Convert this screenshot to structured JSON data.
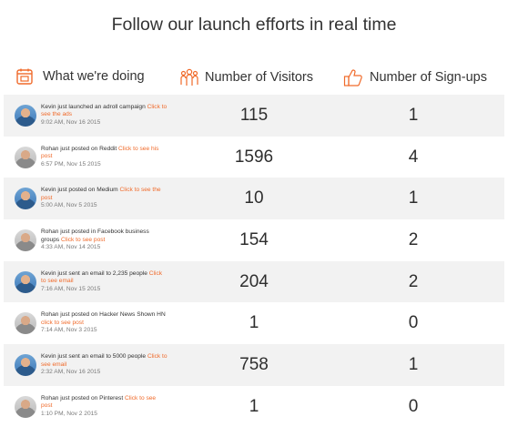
{
  "page": {
    "title": "Follow our launch efforts in real time"
  },
  "header": {
    "doing_label": "What we're doing",
    "visitors_label": "Number of Visitors",
    "signups_label": "Number of Sign-ups",
    "doing_icon": "calendar-icon",
    "visitors_icon": "people-icon",
    "signups_icon": "thumbs-up-icon",
    "accent_color": "#f06a2a"
  },
  "rows": [
    {
      "person": "kevin",
      "text": "Kevin just launched an adroll campaign ",
      "link": "Click to see the ads",
      "time": "9:02 AM, Nov 16 2015",
      "visitors": "115",
      "signups": "1"
    },
    {
      "person": "rohan",
      "text": "Rohan just posted on Reddit ",
      "link": "Click to see his post",
      "time": "6:57 PM, Nov 15 2015",
      "visitors": "1596",
      "signups": "4"
    },
    {
      "person": "kevin",
      "text": "Kevin just posted on Medium ",
      "link": "Click to see the post",
      "time": "5:00 AM, Nov 5 2015",
      "visitors": "10",
      "signups": "1"
    },
    {
      "person": "rohan",
      "text": "Rohan just posted in Facebook business groups ",
      "link": "Click to see post",
      "time": "4:33 AM, Nov 14 2015",
      "visitors": "154",
      "signups": "2"
    },
    {
      "person": "kevin",
      "text": "Kevin just sent an email to 2,235 people ",
      "link": "Click to see email",
      "time": "7:16 AM, Nov 15 2015",
      "visitors": "204",
      "signups": "2"
    },
    {
      "person": "rohan",
      "text": "Rohan just posted on Hacker News Shown HN ",
      "link": "click to see post",
      "time": "7:14 AM, Nov 3 2015",
      "visitors": "1",
      "signups": "0"
    },
    {
      "person": "kevin",
      "text": "Kevin just sent an email to 5000 people ",
      "link": "Click to see email",
      "time": "2:32 AM, Nov 16 2015",
      "visitors": "758",
      "signups": "1"
    },
    {
      "person": "rohan",
      "text": "Rohan just posted on Pinterest ",
      "link": "Click to see post",
      "time": "1:10 PM, Nov 2 2015",
      "visitors": "1",
      "signups": "0"
    }
  ]
}
